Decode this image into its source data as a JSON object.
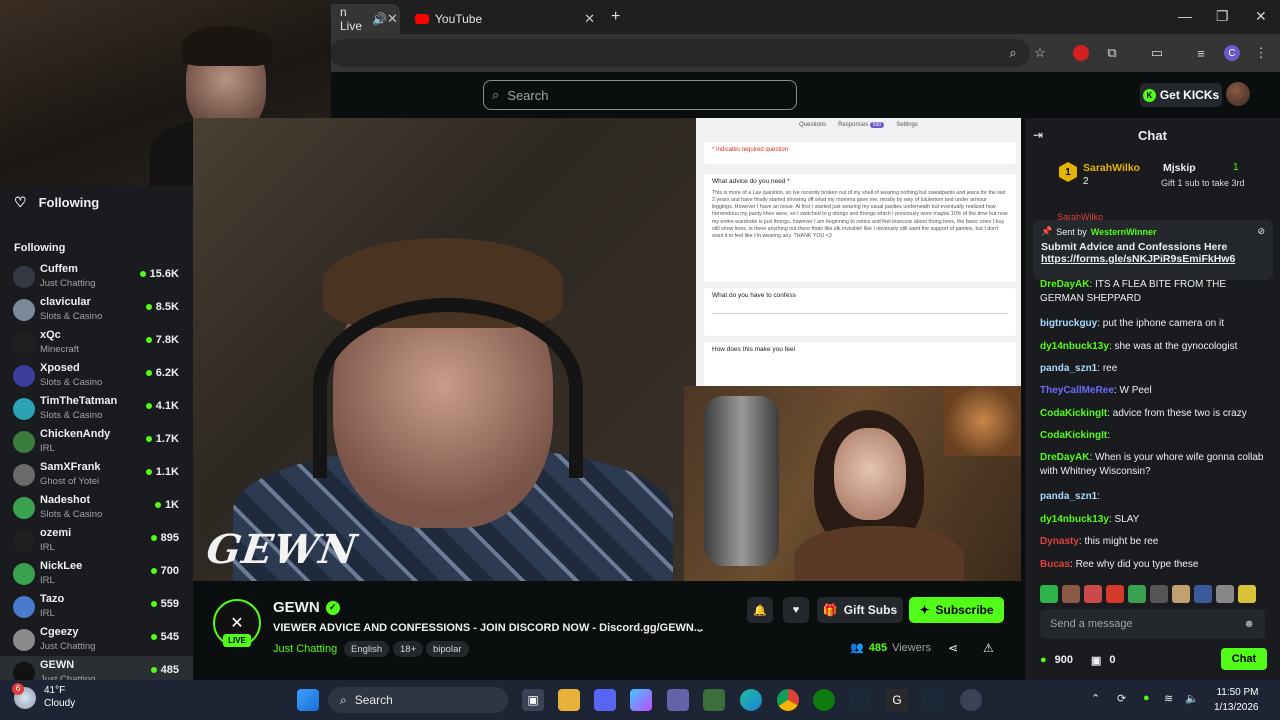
{
  "browser": {
    "tabs": [
      {
        "label": "n Live",
        "active": true
      },
      {
        "label": "YouTube",
        "active": false
      }
    ],
    "new_tab": "+",
    "profile_initial": "C"
  },
  "header": {
    "search_placeholder": "Search",
    "get_kicks": "Get KICKs"
  },
  "sidebar": {
    "following_title": "Following",
    "following_label": "Following",
    "channels": [
      {
        "name": "Cuffem",
        "category": "Just Chatting",
        "viewers": "15.6K",
        "color": "#333a44"
      },
      {
        "name": "clavicular",
        "category": "Slots & Casino",
        "viewers": "8.5K",
        "color": "#7b8a99"
      },
      {
        "name": "xQc",
        "category": "Minecraft",
        "viewers": "7.8K",
        "color": "#202020"
      },
      {
        "name": "Xposed",
        "category": "Slots & Casino",
        "viewers": "6.2K",
        "color": "#3c3a9a"
      },
      {
        "name": "TimTheTatman",
        "category": "Slots & Casino",
        "viewers": "4.1K",
        "color": "#2aa3b5"
      },
      {
        "name": "ChickenAndy",
        "category": "IRL",
        "viewers": "1.7K",
        "color": "#3a7d3a"
      },
      {
        "name": "SamXFrank",
        "category": "Ghost of Yotei",
        "viewers": "1.1K",
        "color": "#6a6a6a"
      },
      {
        "name": "Nadeshot",
        "category": "Slots & Casino",
        "viewers": "1K",
        "color": "#3aa150"
      },
      {
        "name": "ozemi",
        "category": "IRL",
        "viewers": "895",
        "color": "#202020"
      },
      {
        "name": "NickLee",
        "category": "IRL",
        "viewers": "700",
        "color": "#3aa150"
      },
      {
        "name": "Tazo",
        "category": "IRL",
        "viewers": "559",
        "color": "#4a7acc"
      },
      {
        "name": "Cgeezy",
        "category": "Just Chatting",
        "viewers": "545",
        "color": "#8a8a8a"
      },
      {
        "name": "GEWN",
        "category": "Just Chatting",
        "viewers": "485",
        "color": "#111111"
      }
    ]
  },
  "video": {
    "overlay_logo": "GEWN",
    "form": {
      "tabs": [
        "Questions",
        "Responses",
        "Settings"
      ],
      "responses_count": "500",
      "required_note": "* Indicates required question",
      "q1": "What advice do you need *",
      "a1": "This is more of a Lav question, so Ive recently broken out of my shell of wearing nothing but sweatpants and jeans for the last 2 years and have finally started showing off what my momma gave me, mostly by way of lululemon and under armour leggings. However I have an issue. At first I started just wearing my usual panties underneath but eventually realized how horrendous my panty lines were, so I switched to g strings and thongs which I previously wore maybe 10% of the time but now my entire wardrobe is just thongs, however I am beginning to notice and feel insecure about thong lines, the basic ones I buy still show lines, is there anything out there thats like idk invisible! like I obviously still want the support of panties, but I don't want it to feel like I'm wearing any. THANK YOU <3",
      "q2": "What do you have to confess",
      "q3": "How does this make you feel"
    }
  },
  "stream": {
    "channel": "GEWN",
    "live": "LIVE",
    "title": "VIEWER ADVICE AND CONFESSIONS - JOIN DISCORD NOW - Discord.gg/GEWN...",
    "category": "Just Chatting",
    "tags": [
      "English",
      "18+",
      "bipolar"
    ],
    "viewers_count": "485",
    "viewers_label": "Viewers",
    "gift_subs": "Gift Subs",
    "subscribe": "Subscribe"
  },
  "chat": {
    "title": "Chat",
    "leaderboard": {
      "rank": "1",
      "first_user": "SarahWilko",
      "first_count": "2",
      "second_user": "Mjskip",
      "second_count": "1",
      "gift_hint": "Gift 1 sub to take 3rd",
      "hidden_user": "SarahWilko"
    },
    "pinned": {
      "sent_by": "Sent by",
      "pinned_user": "WesternWinner",
      "text": "Submit Advice and Confessions Here",
      "link": "https://forms.gle/sNKJPiR9sEmiFkHw6"
    },
    "messages": [
      {
        "user": "DreDayAK",
        "color": "#53fc18",
        "text": "ITS A FLEA BITE FROM THE GERMAN SHEPPARD"
      },
      {
        "user": "bigtruckguy",
        "color": "#a8d8ff",
        "text": "put the iphone camera on it"
      },
      {
        "user": "dy14nbuck13y",
        "color": "#53fc18",
        "text": "she was at the gynocologist"
      },
      {
        "user": "panda_szn1",
        "color": "#a8d8ff",
        "text": "ree"
      },
      {
        "user": "TheyCallMeRee",
        "color": "#6b6bff",
        "text": "W Peel"
      },
      {
        "user": "CodaKickingIt",
        "color": "#53fc18",
        "text": "advice from these two is crazy"
      },
      {
        "user": "CodaKickingIt",
        "color": "#53fc18",
        "text": ""
      },
      {
        "user": "DreDayAK",
        "color": "#53fc18",
        "text": "When is your whore wife gonna collab with Whitney Wisconsin?"
      },
      {
        "user": "panda_szn1",
        "color": "#a8d8ff",
        "text": ""
      },
      {
        "user": "dy14nbuck13y",
        "color": "#53fc18",
        "text": "SLAY"
      },
      {
        "user": "Dynasty",
        "color": "#e0413a",
        "text": "this might be ree"
      },
      {
        "user": "Bucas",
        "color": "#e0413a",
        "text": "Ree why did you type these"
      }
    ],
    "input_placeholder": "Send a message",
    "points": "900",
    "drops": "0",
    "send": "Chat"
  },
  "taskbar": {
    "weather_badge": "6",
    "temp": "41°F",
    "condition": "Cloudy",
    "search": "Search",
    "time": "11:50 PM",
    "date": "1/13/2026"
  }
}
